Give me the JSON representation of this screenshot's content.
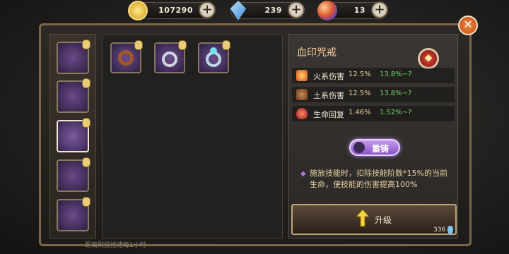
{
  "currencies": [
    {
      "icon": "gold-coin-icon",
      "value": "107290",
      "color": "#f0c23a"
    },
    {
      "icon": "blue-crystal-icon",
      "value": "239",
      "color": "#6fb8f0"
    },
    {
      "icon": "orb-icon",
      "value": "13",
      "color": "#e86a3a"
    }
  ],
  "plus_label": "+",
  "left_slots": [
    {
      "name": "wing-armor-slot"
    },
    {
      "name": "boots-slot"
    },
    {
      "name": "ring-slot"
    },
    {
      "name": "necklace-slot"
    },
    {
      "name": "claw-weapon-slot"
    }
  ],
  "ring_items": [
    {
      "name": "bronze-ring"
    },
    {
      "name": "silver-gem-ring"
    },
    {
      "name": "cyan-gem-ring"
    }
  ],
  "detail": {
    "title": "血印咒戒",
    "stats": [
      {
        "icon": "fire-icon",
        "name": "火系伤害",
        "value": "12.5%",
        "range": "13.8%~?"
      },
      {
        "icon": "earth-icon",
        "name": "土系伤害",
        "value": "12.5%",
        "range": "13.8%~?"
      },
      {
        "icon": "potion-icon",
        "name": "生命回复",
        "value": "1.46%",
        "range": "1.52%~?"
      }
    ],
    "recast_label": "重铸",
    "description": "施放技能时，扣除技能阶数*15%的当前生命，使技能的伤害提高100%",
    "upgrade_label": "升级",
    "upgrade_cost": "336"
  },
  "bottom_text": "距离刷技挂速每1小时"
}
